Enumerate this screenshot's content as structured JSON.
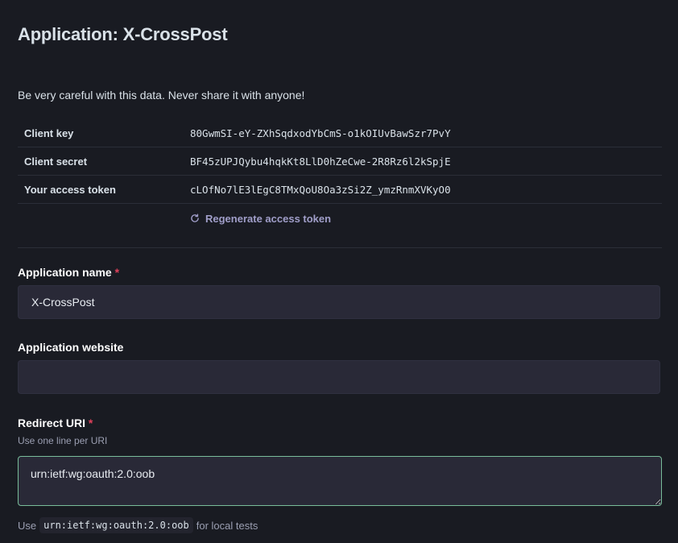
{
  "page": {
    "title": "Application: X-CrossPost",
    "warning": "Be very careful with this data. Never share it with anyone!"
  },
  "credentials": [
    {
      "label": "Client key",
      "value": "80GwmSI-eY-ZXhSqdxodYbCmS-o1kOIUvBawSzr7PvY"
    },
    {
      "label": "Client secret",
      "value": "BF45zUPJQybu4hqkKt8LlD0hZeCwe-2R8Rz6l2kSpjE"
    },
    {
      "label": "Your access token",
      "value": "cLOfNo7lE3lEgC8TMxQoU8Oa3zSi2Z_ymzRnmXVKyO0"
    }
  ],
  "regenerate": {
    "label": "Regenerate access token",
    "icon": "refresh-icon"
  },
  "form": {
    "app_name": {
      "label": "Application name",
      "required_mark": "*",
      "value": "X-CrossPost",
      "placeholder": ""
    },
    "app_website": {
      "label": "Application website",
      "value": "",
      "placeholder": ""
    },
    "redirect_uri": {
      "label": "Redirect URI",
      "required_mark": "*",
      "hint": "Use one line per URI",
      "value": "urn:ietf:wg:oauth:2.0:oob"
    },
    "footer_hint": {
      "prefix": "Use",
      "code": "urn:ietf:wg:oauth:2.0:oob",
      "suffix": "for local tests"
    }
  },
  "colors": {
    "background": "#191b22",
    "accent": "#79bd9a",
    "link": "#a09ec9",
    "required": "#df405a"
  }
}
